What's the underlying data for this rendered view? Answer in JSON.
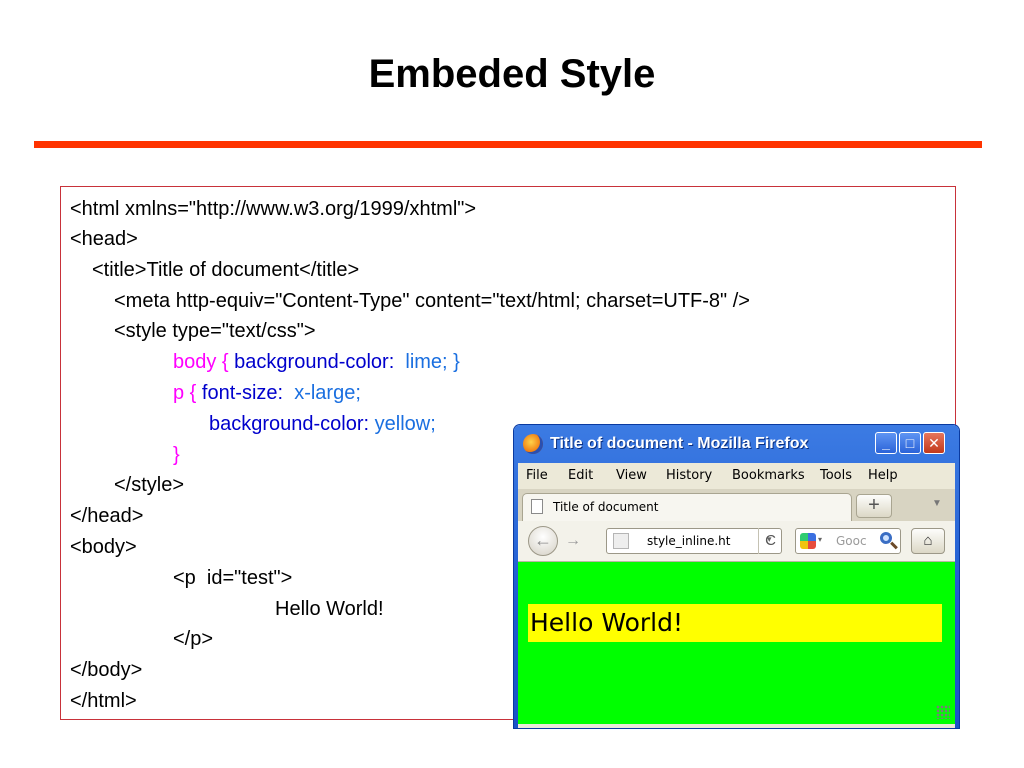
{
  "slide": {
    "title": "Embeded Style"
  },
  "code": {
    "line1": "<html xmlns=\"http://www.w3.org/1999/xhtml\">",
    "line2": "<head>",
    "line3": "<title>Title of document</title>",
    "line4": "<meta http-equiv=\"Content-Type\" content=\"text/html; charset=UTF-8\" />",
    "line5": "<style type=\"text/css\">",
    "line6": {
      "selector": "body { ",
      "property": "background-color:",
      "value": "  lime; }"
    },
    "line7": {
      "selector": "p { ",
      "property": "font-size:",
      "value": "  x-large;"
    },
    "line8": {
      "property": "background-color:",
      "value": " yellow;"
    },
    "line9": "}",
    "line10": "</style>",
    "line11": "</head>",
    "line12": "<body>",
    "line13": "<p  id=\"test\">",
    "line14": "Hello World!",
    "line15": "</p>",
    "line16": "</body>",
    "line17": "</html>"
  },
  "browser": {
    "window_title": "Title of document - Mozilla Firefox",
    "controls": {
      "minimize": "_",
      "maximize": "□",
      "close": "✕"
    },
    "menu": [
      "File",
      "Edit",
      "View",
      "History",
      "Bookmarks",
      "Tools",
      "Help"
    ],
    "tab_title": "Title of document",
    "new_tab": "+",
    "back": "←",
    "forward": "→",
    "address": "style_inline.ht",
    "address_dropdown": "▾",
    "reload": "C",
    "search_placeholder": "Gooc",
    "search_engine_dropdown": "▾",
    "home": "⌂",
    "page_content": "Hello World!"
  },
  "colors": {
    "rule": "#ff3300",
    "code_border": "#c8323a",
    "css_selector": "#ff00ff",
    "css_property": "#0000cc",
    "css_value": "#1a6fe0",
    "page_background": "#00ff00",
    "paragraph_background": "#ffff00"
  },
  "icons": {
    "firefox_logo": "firefox-logo-icon",
    "tab_page": "page-icon",
    "search_engine": "google-icon",
    "search": "magnifier-icon",
    "home": "home-icon",
    "resize": "resize-grip-icon"
  }
}
